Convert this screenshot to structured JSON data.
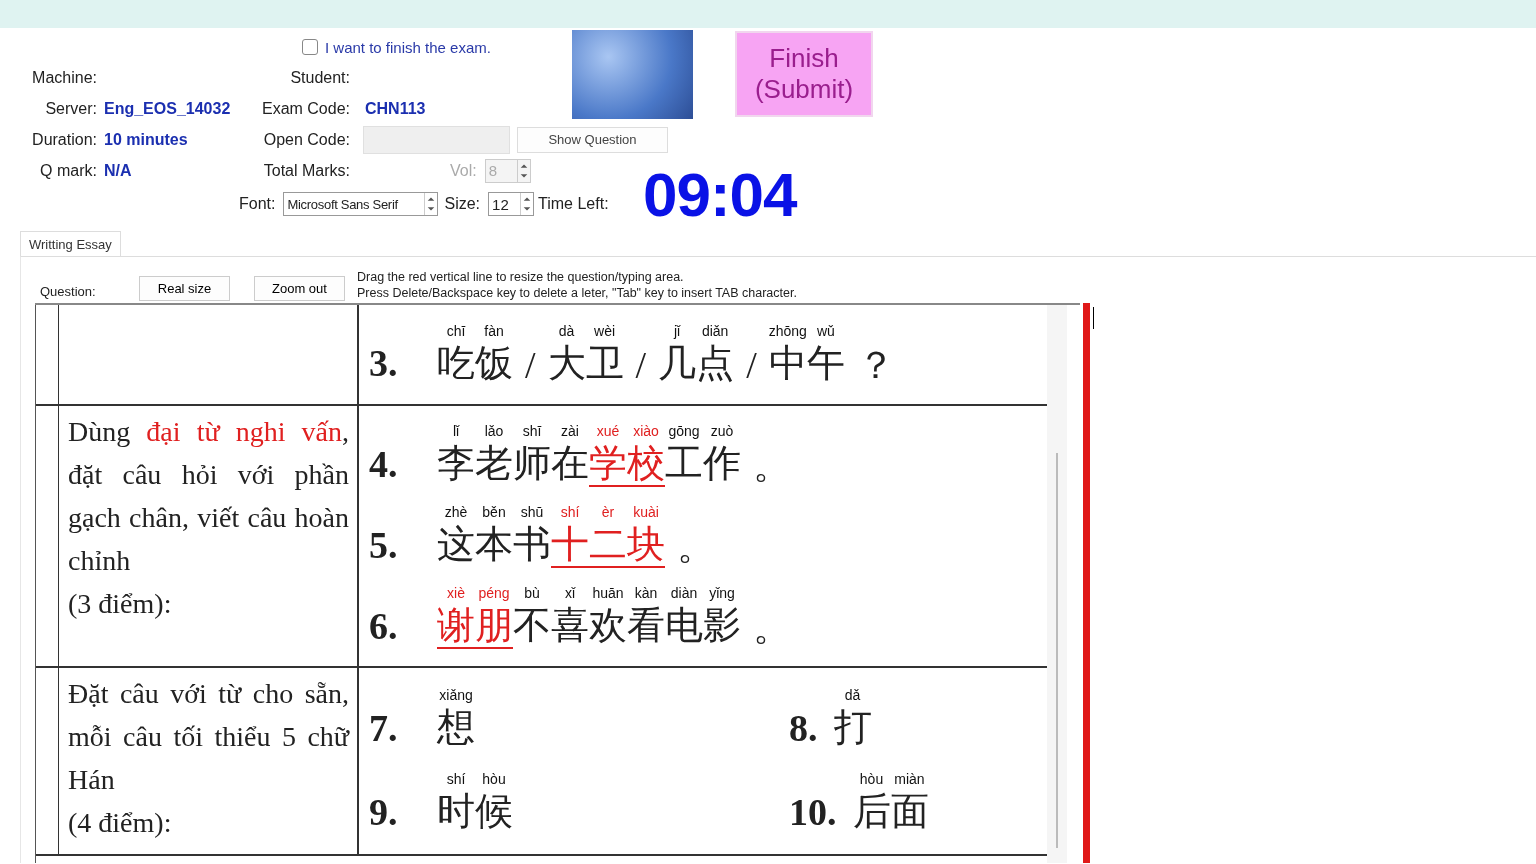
{
  "finish_checkbox": {
    "label": "I want to finish the exam.",
    "checked": false
  },
  "info": {
    "machine_label": "Machine:",
    "student_label": "Student:",
    "server_label": "Server:",
    "server": "Eng_EOS_14032",
    "exam_code_label": "Exam Code:",
    "exam_code": "CHN113",
    "duration_label": "Duration:",
    "duration": "10 minutes",
    "open_code_label": "Open Code:",
    "q_mark_label": "Q mark:",
    "q_mark": "N/A",
    "total_marks_label": "Total Marks:"
  },
  "show_question_button": "Show Question",
  "vol": {
    "label": "Vol:",
    "value": "8",
    "disabled": true
  },
  "font": {
    "label": "Font:",
    "value": "Microsoft Sans Serif"
  },
  "size": {
    "label": "Size:",
    "value": "12"
  },
  "time_left": {
    "label": "Time Left:",
    "value": "09:04"
  },
  "finish_button": "Finish (Submit)",
  "tabs": [
    {
      "label": "Writting Essay",
      "selected": true
    }
  ],
  "toolbar": {
    "label": "Question:",
    "buttons": [
      "Real size",
      "Zoom out"
    ],
    "hints": [
      "Drag the red vertical line to resize the question/typing area.",
      "Press Delete/Backspace key to delete a leter, \"Tab\" key to insert TAB character."
    ]
  },
  "document": {
    "rows": [
      {
        "instruction": [],
        "points": "",
        "kind": "list",
        "items": [
          {
            "number": "3.",
            "segments": [
              {
                "chars": [
                  {
                    "hanzi": "吃",
                    "pinyin": "chī"
                  },
                  {
                    "hanzi": "饭",
                    "pinyin": "fàn"
                  }
                ],
                "marked": false
              },
              {
                "text": "/"
              },
              {
                "chars": [
                  {
                    "hanzi": "大",
                    "pinyin": "dà"
                  },
                  {
                    "hanzi": "卫",
                    "pinyin": "wèi"
                  }
                ],
                "marked": false
              },
              {
                "text": "/"
              },
              {
                "chars": [
                  {
                    "hanzi": "几",
                    "pinyin": "jǐ"
                  },
                  {
                    "hanzi": "点",
                    "pinyin": "diǎn"
                  }
                ],
                "marked": false
              },
              {
                "text": "/"
              },
              {
                "chars": [
                  {
                    "hanzi": "中",
                    "pinyin": "zhōng"
                  },
                  {
                    "hanzi": "午",
                    "pinyin": "wǔ"
                  }
                ],
                "marked": false
              },
              {
                "text": "？"
              }
            ]
          }
        ]
      },
      {
        "instruction": [
          {
            "text": "Dùng ",
            "highlight": false
          },
          {
            "text": "đại từ nghi vấn",
            "highlight": true
          },
          {
            "text": ", đặt câu hỏi với phần gạch chân, viết câu hoàn chỉnh",
            "highlight": false
          }
        ],
        "points": "(3 điểm):",
        "kind": "list",
        "items": [
          {
            "number": "4.",
            "segments": [
              {
                "chars": [
                  {
                    "hanzi": "李",
                    "pinyin": "lǐ"
                  },
                  {
                    "hanzi": "老",
                    "pinyin": "lǎo"
                  },
                  {
                    "hanzi": "师",
                    "pinyin": "shī"
                  },
                  {
                    "hanzi": "在",
                    "pinyin": "zài"
                  }
                ],
                "marked": false
              },
              {
                "chars": [
                  {
                    "hanzi": "学",
                    "pinyin": "xué"
                  },
                  {
                    "hanzi": "校",
                    "pinyin": "xiào"
                  }
                ],
                "marked": true
              },
              {
                "chars": [
                  {
                    "hanzi": "工",
                    "pinyin": "gōng"
                  },
                  {
                    "hanzi": "作",
                    "pinyin": "zuò"
                  }
                ],
                "marked": false
              },
              {
                "text": "。"
              }
            ]
          },
          {
            "number": "5.",
            "segments": [
              {
                "chars": [
                  {
                    "hanzi": "这",
                    "pinyin": "zhè"
                  },
                  {
                    "hanzi": "本",
                    "pinyin": "běn"
                  },
                  {
                    "hanzi": "书",
                    "pinyin": "shū"
                  }
                ],
                "marked": false
              },
              {
                "chars": [
                  {
                    "hanzi": "十",
                    "pinyin": "shí"
                  },
                  {
                    "hanzi": "二",
                    "pinyin": "èr"
                  },
                  {
                    "hanzi": "块",
                    "pinyin": "kuài"
                  }
                ],
                "marked": true
              },
              {
                "text": "。"
              }
            ]
          },
          {
            "number": "6.",
            "segments": [
              {
                "chars": [
                  {
                    "hanzi": "谢",
                    "pinyin": "xiè"
                  },
                  {
                    "hanzi": "朋",
                    "pinyin": "péng"
                  }
                ],
                "marked": true
              },
              {
                "chars": [
                  {
                    "hanzi": "不",
                    "pinyin": "bù"
                  },
                  {
                    "hanzi": "喜",
                    "pinyin": "xǐ"
                  },
                  {
                    "hanzi": "欢",
                    "pinyin": "huān"
                  },
                  {
                    "hanzi": "看",
                    "pinyin": "kàn"
                  },
                  {
                    "hanzi": "电",
                    "pinyin": "diàn"
                  },
                  {
                    "hanzi": "影",
                    "pinyin": "yǐng"
                  }
                ],
                "marked": false
              },
              {
                "text": "。"
              }
            ]
          }
        ]
      },
      {
        "instruction": [
          {
            "text": "Đặt câu với từ cho sẵn, mỗi câu tối thiểu 5 chữ Hán",
            "highlight": false
          }
        ],
        "points": "(4 điểm):",
        "kind": "grid",
        "items": [
          {
            "number": "7.",
            "segments": [
              {
                "chars": [
                  {
                    "hanzi": "想",
                    "pinyin": "xiǎng"
                  }
                ],
                "marked": false
              }
            ]
          },
          {
            "number": "8.",
            "segments": [
              {
                "chars": [
                  {
                    "hanzi": "打",
                    "pinyin": "dǎ"
                  }
                ],
                "marked": false
              }
            ]
          },
          {
            "number": "9.",
            "segments": [
              {
                "chars": [
                  {
                    "hanzi": "时",
                    "pinyin": "shí"
                  },
                  {
                    "hanzi": "候",
                    "pinyin": "hòu"
                  }
                ],
                "marked": false
              }
            ]
          },
          {
            "number": "10.",
            "segments": [
              {
                "chars": [
                  {
                    "hanzi": "后",
                    "pinyin": "hòu"
                  },
                  {
                    "hanzi": "面",
                    "pinyin": "miàn"
                  }
                ],
                "marked": false
              }
            ]
          }
        ]
      }
    ]
  }
}
